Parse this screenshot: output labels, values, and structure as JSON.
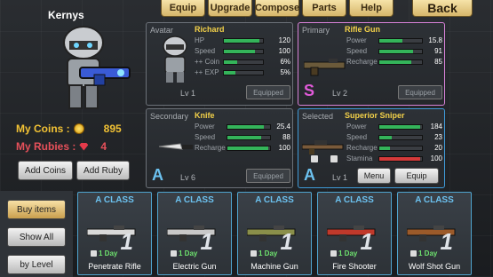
{
  "nav": {
    "equip": "Equip",
    "upgrade": "Upgrade",
    "compose": "Compose",
    "parts": "Parts",
    "help": "Help",
    "back": "Back"
  },
  "player": {
    "name": "Kernys",
    "coins_label": "My Coins :",
    "coins_value": "895",
    "rubies_label": "My Rubies :",
    "rubies_value": "4",
    "add_coins": "Add Coins",
    "add_ruby": "Add Ruby"
  },
  "avatar_panel": {
    "tag": "Avatar",
    "name": "Richard",
    "stats": [
      {
        "label": "HP",
        "value": "120",
        "fill": 0.9
      },
      {
        "label": "Speed",
        "value": "100",
        "fill": 0.8
      },
      {
        "label": "++ Coin",
        "value": "6%",
        "fill": 0.35
      },
      {
        "label": "++ EXP",
        "value": "5%",
        "fill": 0.3
      }
    ],
    "level": "Lv 1",
    "status": "Equipped"
  },
  "primary_panel": {
    "tag": "Primary",
    "name": "Rifle Gun",
    "stats": [
      {
        "label": "Power",
        "value": "15.8",
        "fill": 0.55
      },
      {
        "label": "Speed",
        "value": "91",
        "fill": 0.8
      },
      {
        "label": "Recharge",
        "value": "85",
        "fill": 0.75
      }
    ],
    "class_letter": "S",
    "level": "Lv 2",
    "status": "Equipped"
  },
  "secondary_panel": {
    "tag": "Secondary",
    "name": "Knife",
    "stats": [
      {
        "label": "Power",
        "value": "25.4",
        "fill": 0.85
      },
      {
        "label": "Speed",
        "value": "88",
        "fill": 0.8
      },
      {
        "label": "Recharge",
        "value": "100",
        "fill": 0.95
      }
    ],
    "class_letter": "A",
    "level": "Lv 6",
    "status": "Equipped"
  },
  "selected_panel": {
    "tag": "Selected",
    "name": "Superior Sniper",
    "stats": [
      {
        "label": "Power",
        "value": "184",
        "fill": 0.95
      },
      {
        "label": "Speed",
        "value": "23",
        "fill": 0.3
      },
      {
        "label": "Recharge",
        "value": "20",
        "fill": 0.25
      },
      {
        "label": "Stamina",
        "value": "100",
        "fill": 0.95,
        "color": "red"
      }
    ],
    "class_letter": "A",
    "level": "Lv 1",
    "menu": "Menu",
    "equip": "Equip"
  },
  "filters": {
    "buy_items": "Buy items",
    "show_all": "Show All",
    "by_level": "by Level"
  },
  "cards": [
    {
      "class": "A CLASS",
      "name": "Penetrate Rifle",
      "days": "1 Day",
      "num": "1"
    },
    {
      "class": "A CLASS",
      "name": "Electric Gun",
      "days": "1 Day",
      "num": "1"
    },
    {
      "class": "A CLASS",
      "name": "Machine Gun",
      "days": "1 Day",
      "num": "1"
    },
    {
      "class": "A CLASS",
      "name": "Fire Shooter",
      "days": "1 Day",
      "num": "1"
    },
    {
      "class": "A CLASS",
      "name": "Wolf Shot Gun",
      "days": "1 Day",
      "num": "1"
    }
  ],
  "colors": {
    "gold": "#f2c234",
    "ruby": "#e6505a",
    "primary_border": "#d882d8",
    "selected_border": "#3f9bd9",
    "class_blue": "#6cc2f0",
    "class_pink": "#e05ad8"
  }
}
